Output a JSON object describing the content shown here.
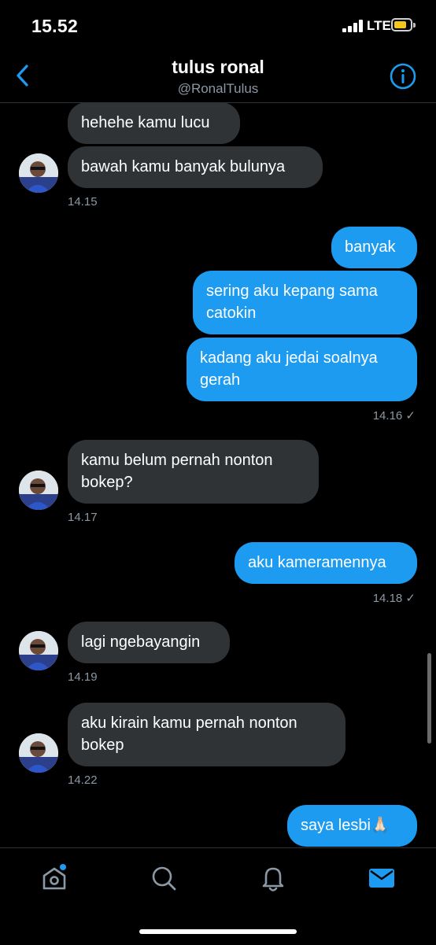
{
  "status": {
    "time": "15.52",
    "network": "LTE"
  },
  "header": {
    "title": "tulus ronal",
    "handle": "@RonalTulus"
  },
  "messages": [
    {
      "text": "hehehe kamu lucu"
    },
    {
      "text": "bawah kamu banyak bulunya"
    },
    {
      "text": "14.15"
    },
    {
      "text": "banyak"
    },
    {
      "text": "sering aku kepang sama\ncatokin"
    },
    {
      "text": "kadang aku jedai soalnya\ngerah"
    },
    {
      "text": "14.16 ✓"
    },
    {
      "text": "kamu belum pernah nonton\nbokep?"
    },
    {
      "text": "14.17"
    },
    {
      "text": "aku kameramennya"
    },
    {
      "text": "14.18 ✓"
    },
    {
      "text": "lagi ngebayangin"
    },
    {
      "text": "14.19"
    },
    {
      "text": "aku kirain kamu pernah nonton\nbokep"
    },
    {
      "text": "14.22"
    },
    {
      "text": "saya lesbi🙏🏻"
    }
  ],
  "colors": {
    "outgoing_bubble": "#1d9bf0",
    "incoming_bubble": "#2f3336",
    "accent": "#1d9bf0",
    "background": "#000000"
  },
  "tabs": [
    {
      "icon": "home-icon"
    },
    {
      "icon": "search-icon"
    },
    {
      "icon": "bell-icon"
    },
    {
      "icon": "mail-icon"
    }
  ]
}
